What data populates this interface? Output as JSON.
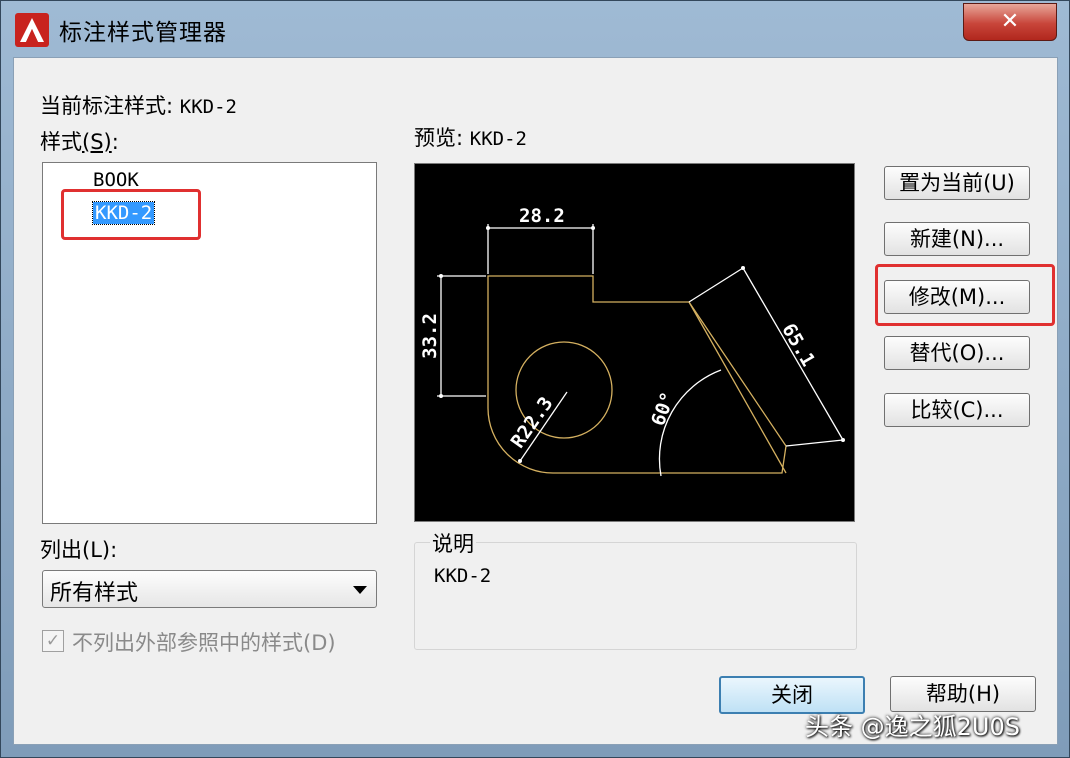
{
  "window": {
    "title": "标注样式管理器",
    "close_label": "✕"
  },
  "current_style": {
    "label": "当前标注样式:",
    "value": "KKD-2"
  },
  "styles": {
    "label_prefix": "样式",
    "label_mnemonic": "(S)",
    "label_suffix": ":",
    "items": [
      "BOOK",
      "KKD-2"
    ],
    "selected": "KKD-2"
  },
  "preview": {
    "label": "预览:",
    "value": "KKD-2",
    "dimensions": {
      "top": "28.2",
      "left": "33.2",
      "radius": "R22.3",
      "angle": "60°",
      "diagonal": "65.1"
    }
  },
  "buttons": {
    "set_current": "置为当前(U)",
    "new": "新建(N)...",
    "modify": "修改(M)...",
    "override": "替代(O)...",
    "compare": "比较(C)...",
    "close": "关闭",
    "help": "帮助(H)"
  },
  "description": {
    "label": "说明",
    "value": "KKD-2"
  },
  "list": {
    "label": "列出(L):",
    "selected": "所有样式"
  },
  "exclude_xref": {
    "label": "不列出外部参照中的样式(D)",
    "checked": true
  },
  "watermark": "头条 @逸之狐2U0S",
  "colors": {
    "highlight_box": "#e03030",
    "selection": "#3399ff",
    "preview_background": "#000000",
    "preview_outline": "#d4b060",
    "preview_dims": "#ffffff"
  }
}
